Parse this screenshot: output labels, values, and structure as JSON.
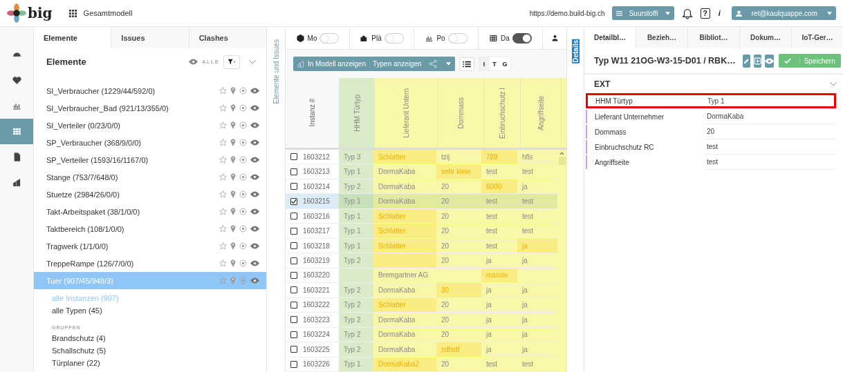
{
  "header": {
    "logo": "big",
    "project": "Gesamtmodell",
    "url": "https://demo.build-big.ch",
    "workspace": "Suurstoffi",
    "help": "?",
    "info": "i",
    "user": "ret@kaulquappe.com"
  },
  "rail": [
    {
      "selected": false
    },
    {
      "selected": false
    },
    {
      "selected": false
    },
    {
      "selected": true
    },
    {
      "selected": false
    },
    {
      "selected": false
    }
  ],
  "left_tabs": [
    {
      "label": "Elemente",
      "selected": true
    },
    {
      "label": "Issues",
      "selected": false
    },
    {
      "label": "Clashes",
      "selected": false
    }
  ],
  "elements": {
    "title": "Elemente",
    "filter_label": "ALLE",
    "expanded": true,
    "items": [
      {
        "label": "SI_Verbraucher (1229/44/592/0)",
        "selected": false
      },
      {
        "label": "SI_Verbraucher_Bad (921/13/355/0)",
        "selected": false
      },
      {
        "label": "SI_Verteiler (0/23/0/0)",
        "selected": false
      },
      {
        "label": "SP_Verbraucher (368/9/0/0)",
        "selected": false
      },
      {
        "label": "SP_Verteiler (1593/16/1167/0)",
        "selected": false
      },
      {
        "label": "Stange (753/7/648/0)",
        "selected": false
      },
      {
        "label": "Stuetze (2984/26/0/0)",
        "selected": false
      },
      {
        "label": "Takt-Arbeitspaket (38/1/0/0)",
        "selected": false
      },
      {
        "label": "Taktbereich (108/1/0/0)",
        "selected": false
      },
      {
        "label": "Tragwerk (1/1/0/0)",
        "selected": false
      },
      {
        "label": "TreppeRampe (126/7/0/0)",
        "selected": false
      },
      {
        "label": "Tuer (907/45/949/3)",
        "selected": true
      }
    ],
    "sub_items": [
      {
        "label": "alle Instanzen (907)",
        "selected": true
      },
      {
        "label": "alle Typen (45)",
        "selected": false
      }
    ],
    "groups_title": "GRUPPEN",
    "groups": [
      "Brandschutz (4)",
      "Schallschutz (5)",
      "Türplaner (22)"
    ]
  },
  "side_strip": "Elemente und Issues",
  "views": [
    {
      "label": "Mo",
      "on": false
    },
    {
      "label": "Plä",
      "on": false
    },
    {
      "label": "Po",
      "on": false
    },
    {
      "label": "Da",
      "on": true
    }
  ],
  "toolbar": {
    "show_in_model": "In Modell anzeigen",
    "show_types": "Typen anzeigen",
    "modes": [
      {
        "label": "I",
        "selected": true
      },
      {
        "label": "T",
        "selected": false
      },
      {
        "label": "G",
        "selected": false
      }
    ]
  },
  "table": {
    "columns": [
      {
        "label": "Instanz #"
      },
      {
        "label": "HHM Türtyp",
        "color": "#d9ebc9"
      },
      {
        "label": "Lieferant Untern",
        "color": "#f9f7a8"
      },
      {
        "label": "Dornmass",
        "color": "#f9f7a8"
      },
      {
        "label": "Einbruchschutz I",
        "color": "#f9f7a8"
      },
      {
        "label": "Angriffseite",
        "color": "#f9f7a8"
      }
    ],
    "rows": [
      {
        "checked": false,
        "cells": [
          {
            "text": "1603212"
          },
          {
            "text": "Typ 3"
          },
          {
            "text": "Schlatter",
            "changed": true
          },
          {
            "text": "tzij"
          },
          {
            "text": "789",
            "changed": true
          },
          {
            "text": "hfls"
          }
        ]
      },
      {
        "checked": false,
        "cells": [
          {
            "text": "1603213"
          },
          {
            "text": "Typ 1"
          },
          {
            "text": "DormaKaba"
          },
          {
            "text": "sehr klein",
            "changed": true
          },
          {
            "text": "test"
          },
          {
            "text": "test"
          }
        ]
      },
      {
        "checked": false,
        "cells": [
          {
            "text": "1603214"
          },
          {
            "text": "Typ 2"
          },
          {
            "text": "DormaKaba"
          },
          {
            "text": "20"
          },
          {
            "text": "6000",
            "changed": true
          },
          {
            "text": "ja"
          }
        ]
      },
      {
        "checked": true,
        "cells": [
          {
            "text": "1603215"
          },
          {
            "text": "Typ 1"
          },
          {
            "text": "DormaKaba"
          },
          {
            "text": "20"
          },
          {
            "text": "test"
          },
          {
            "text": "test"
          }
        ]
      },
      {
        "checked": false,
        "cells": [
          {
            "text": "1603216"
          },
          {
            "text": "Typ 1"
          },
          {
            "text": "Schlatter",
            "changed": true
          },
          {
            "text": "20"
          },
          {
            "text": "test"
          },
          {
            "text": "test"
          }
        ]
      },
      {
        "checked": false,
        "cells": [
          {
            "text": "1603217"
          },
          {
            "text": "Typ 1"
          },
          {
            "text": "Schlatter",
            "changed": true
          },
          {
            "text": "20"
          },
          {
            "text": "test"
          },
          {
            "text": "test"
          }
        ]
      },
      {
        "checked": false,
        "cells": [
          {
            "text": "1603218"
          },
          {
            "text": "Typ 1"
          },
          {
            "text": "Schlatter",
            "changed": true
          },
          {
            "text": "20"
          },
          {
            "text": "test"
          },
          {
            "text": "ja",
            "changed": true
          }
        ]
      },
      {
        "checked": false,
        "cells": [
          {
            "text": "1603219"
          },
          {
            "text": "Typ 2"
          },
          {
            "changed": true
          },
          {
            "text": "20"
          },
          {
            "text": "ja"
          },
          {
            "text": "ja"
          }
        ]
      },
      {
        "checked": false,
        "cells": [
          {
            "text": "1603220"
          },
          {},
          {
            "text": "Bremgartner AG"
          },
          {},
          {
            "text": "massiv",
            "changed": true
          },
          {}
        ]
      },
      {
        "checked": false,
        "cells": [
          {
            "text": "1603221"
          },
          {
            "text": "Typ 2"
          },
          {
            "text": "DormaKaba"
          },
          {
            "text": "30",
            "changed": true
          },
          {
            "text": "ja"
          },
          {
            "text": "ja"
          }
        ]
      },
      {
        "checked": false,
        "cells": [
          {
            "text": "1603222"
          },
          {
            "text": "Typ 2"
          },
          {
            "text": "Schlatter",
            "changed": true
          },
          {
            "text": "20"
          },
          {
            "text": "ja"
          },
          {
            "text": "ja"
          }
        ]
      },
      {
        "checked": false,
        "cells": [
          {
            "text": "1603223"
          },
          {
            "text": "Typ 2"
          },
          {
            "text": "DormaKaba"
          },
          {
            "text": "20"
          },
          {
            "text": "ja"
          },
          {
            "text": "ja"
          }
        ]
      },
      {
        "checked": false,
        "cells": [
          {
            "text": "1603224"
          },
          {
            "text": "Typ 2"
          },
          {
            "text": "DormaKaba"
          },
          {
            "text": "20"
          },
          {
            "text": "ja"
          },
          {
            "text": "ja"
          }
        ]
      },
      {
        "checked": false,
        "cells": [
          {
            "text": "1603225"
          },
          {
            "text": "Typ 2"
          },
          {
            "text": "DormaKaba"
          },
          {
            "text": "sdfsdf",
            "changed": true
          },
          {
            "text": "ja"
          },
          {
            "text": "ja"
          }
        ]
      },
      {
        "checked": false,
        "cells": [
          {
            "text": "1603226"
          },
          {
            "text": "Typ 1"
          },
          {
            "text": "DormaKaba2",
            "changed": true
          },
          {
            "text": "20"
          },
          {
            "text": "test"
          },
          {
            "text": "test"
          }
        ]
      }
    ]
  },
  "details_strip": "Details",
  "right_tabs": [
    {
      "label": "Detailbl…",
      "selected": true
    },
    {
      "label": "Bezieh…",
      "selected": false
    },
    {
      "label": "Bibliot…",
      "selected": false
    },
    {
      "label": "Dokum…",
      "selected": false
    },
    {
      "label": "IoT-Ger…",
      "selected": false
    }
  ],
  "detail": {
    "title": "Typ W11 21OG-W3-15-D01  /  RBK…",
    "save": "Speichern",
    "section": "EXT",
    "expanded": true,
    "properties": [
      {
        "label": "HHM Türtyp",
        "value": "Typ 1",
        "highlighted": true
      },
      {
        "label": "Lieferant Unternehmer",
        "value": "DormaKaba",
        "highlighted": false
      },
      {
        "label": "Dornmass",
        "value": "20",
        "highlighted": false
      },
      {
        "label": "Einbruchschutz RC",
        "value": "test",
        "highlighted": false
      },
      {
        "label": "Angriffseite",
        "value": "test",
        "highlighted": false
      }
    ]
  }
}
